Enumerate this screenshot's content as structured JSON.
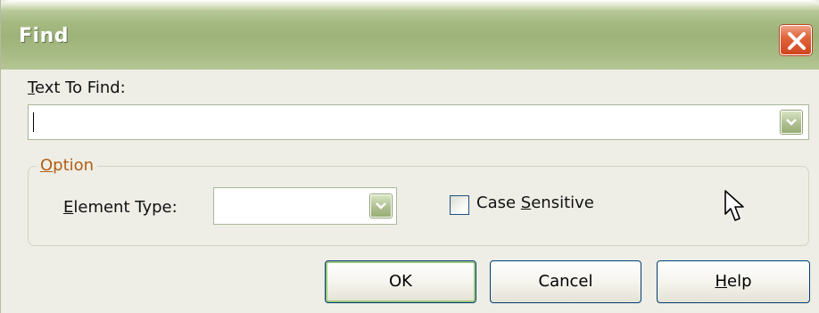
{
  "window": {
    "title": "Find",
    "close_icon": "close-icon"
  },
  "text_to_find": {
    "label_hotkey": "T",
    "label_rest": "ext To Find:",
    "value": ""
  },
  "option_group": {
    "legend_hotkey": "O",
    "legend_rest": "ption"
  },
  "element_type": {
    "label_hotkey": "E",
    "label_rest": "lement Type:",
    "value": ""
  },
  "case_sensitive": {
    "label_before": "Case ",
    "label_hotkey": "S",
    "label_after": "ensitive",
    "checked": false
  },
  "buttons": {
    "ok": "OK",
    "cancel": "Cancel",
    "help_hotkey": "H",
    "help_rest": "elp"
  },
  "colors": {
    "titlebar": "#a6bb82",
    "close_button": "#e0653c",
    "legend_text": "#b45e14",
    "button_border": "#003c74"
  }
}
